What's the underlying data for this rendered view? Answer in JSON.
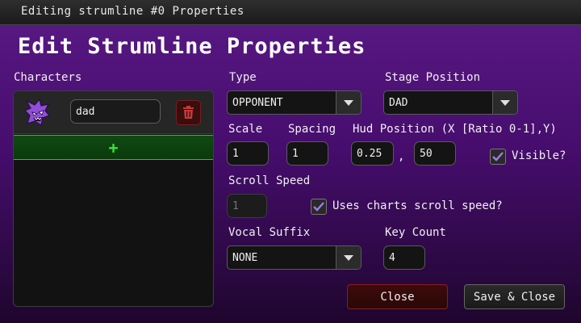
{
  "window": {
    "title": "Editing strumline #0 Properties"
  },
  "heading": "Edit Strumline Properties",
  "characters": {
    "label": "Characters",
    "items": [
      {
        "name": "dad"
      }
    ],
    "add_symbol": "+"
  },
  "type": {
    "label": "Type",
    "value": "OPPONENT"
  },
  "stage_position": {
    "label": "Stage Position",
    "value": "DAD"
  },
  "scale": {
    "label": "Scale",
    "value": "1"
  },
  "spacing": {
    "label": "Spacing",
    "value": "1"
  },
  "hud_position": {
    "label": "Hud Position (X [Ratio 0-1],Y)",
    "x": "0.25",
    "separator": ",",
    "y": "50"
  },
  "visible": {
    "label": "Visible?",
    "checked": true
  },
  "scroll_speed": {
    "label": "Scroll Speed",
    "placeholder": "1",
    "disabled": true
  },
  "uses_chart_speed": {
    "label": "Uses charts scroll speed?",
    "checked": true
  },
  "vocal_suffix": {
    "label": "Vocal Suffix",
    "value": "NONE"
  },
  "key_count": {
    "label": "Key Count",
    "value": "4"
  },
  "buttons": {
    "close": "Close",
    "save_close": "Save & Close"
  },
  "colors": {
    "accent_purple": "#5a1a86",
    "add_green": "#2ac42e",
    "delete_red": "#7a1d1d",
    "check_purple": "#a07be6"
  }
}
